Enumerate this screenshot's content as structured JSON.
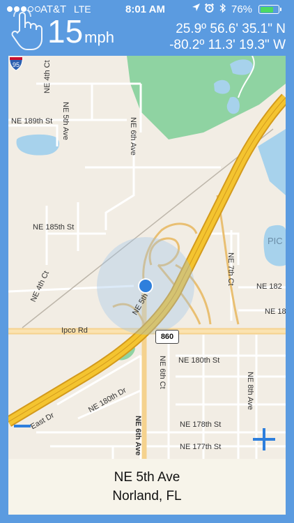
{
  "status_bar": {
    "signal_dots": [
      true,
      true,
      true,
      false,
      false
    ],
    "carrier": "AT&T",
    "network": "LTE",
    "time": "8:01 AM",
    "battery_percent": "76%",
    "battery_level": 0.76,
    "icons": [
      "location-arrow-icon",
      "alarm-icon",
      "bluetooth-icon",
      "battery-icon"
    ]
  },
  "header": {
    "speed": "15",
    "speed_unit": "mph",
    "latitude": "25.9º 56.6' 35.1\" N",
    "longitude": "-80.2º 11.3' 19.3\" W"
  },
  "map": {
    "labels": {
      "ne_4th_ct_top": "NE 4th Ct",
      "ne_5th_ave_top": "NE 5th Ave",
      "ne_189th_st": "NE 189th St",
      "ne_6th_ave_top": "NE 6th Ave",
      "ne_185th_st": "NE 185th St",
      "pio": "PIC",
      "ne_7th_ct": "NE 7th Ct",
      "ne_182": "NE 182",
      "ne_18": "NE 18",
      "ne_4th_ct_bottom": "NE 4th Ct",
      "ne_5th_curve": "NE 5th",
      "ipco_rd": "Ipco Rd",
      "ne_180th_st": "NE 180th St",
      "ne_180th_dr": "NE 180th Dr",
      "ne_6th_ct": "NE 6th Ct",
      "ne_8th_ave": "NE 8th Ave",
      "east_dr": "East Dr",
      "ne_178th_st": "NE 178th St",
      "ne_6th_ave_bottom": "NE 6th Ave",
      "ne_177th_st": "NE 177th St"
    },
    "shields": {
      "interstate": "95",
      "state_route": "860"
    },
    "colors": {
      "land": "#f2ede4",
      "park": "#8fd3a2",
      "water": "#a7d2ec",
      "highway": "#f4c430",
      "highway_edge": "#d39a1c",
      "ramp": "#f5d28e",
      "accent": "#2e7fdc"
    }
  },
  "controls": {
    "zoom_out_label": "zoom out",
    "zoom_in_label": "zoom in"
  },
  "address": {
    "street": "NE 5th Ave",
    "city": "Norland, FL"
  }
}
